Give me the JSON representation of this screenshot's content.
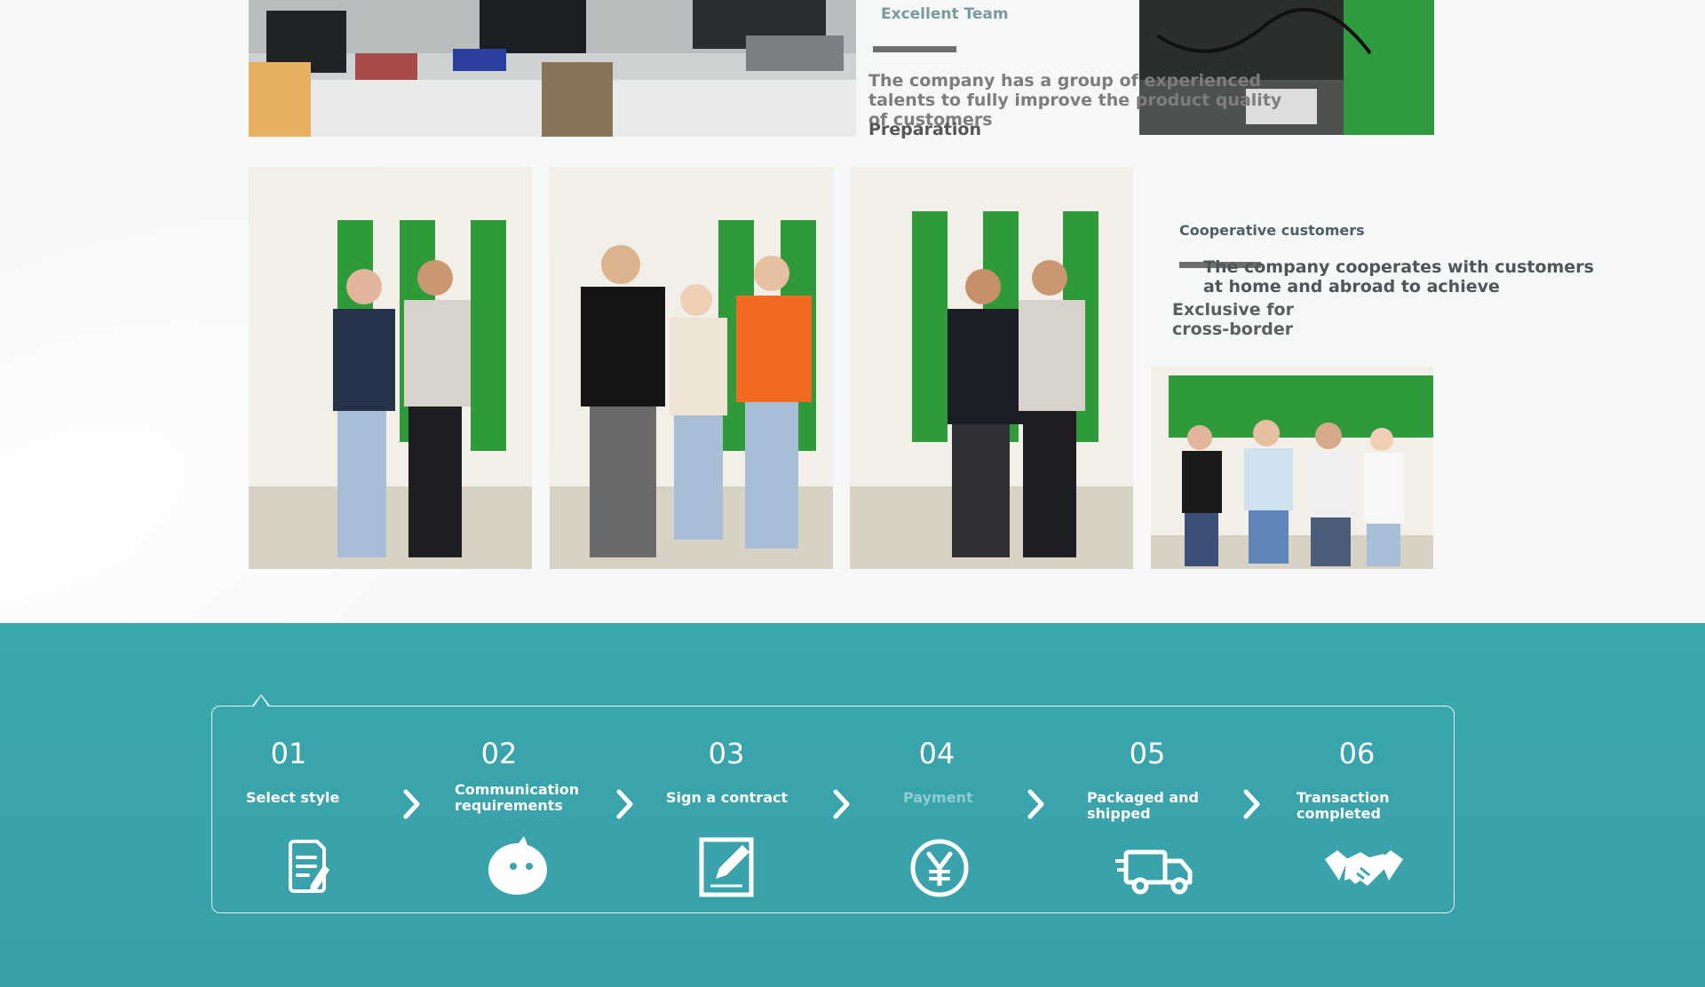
{
  "team": {
    "title": "Excellent Team",
    "description": "The company has a group of experienced talents to fully improve the product quality of customers",
    "preparation": "Preparation"
  },
  "cooperation": {
    "title": "Cooperative customers",
    "description": "The company cooperates with customers at home and abroad to achieve",
    "exclusive": "Exclusive for cross-border"
  },
  "process": {
    "steps": [
      {
        "number": "01",
        "label": "Select style",
        "icon": "document-edit-icon"
      },
      {
        "number": "02",
        "label": "Communication requirements",
        "icon": "chat-bubble-icon"
      },
      {
        "number": "03",
        "label": "Sign a contract",
        "icon": "sign-contract-icon"
      },
      {
        "number": "04",
        "label": "Payment",
        "icon": "yen-coin-icon"
      },
      {
        "number": "05",
        "label": "Packaged and shipped",
        "icon": "delivery-truck-icon"
      },
      {
        "number": "06",
        "label": "Transaction completed",
        "icon": "handshake-icon"
      }
    ]
  },
  "colors": {
    "band": "#38a8ae",
    "muted_label": "#8fcdd1"
  }
}
